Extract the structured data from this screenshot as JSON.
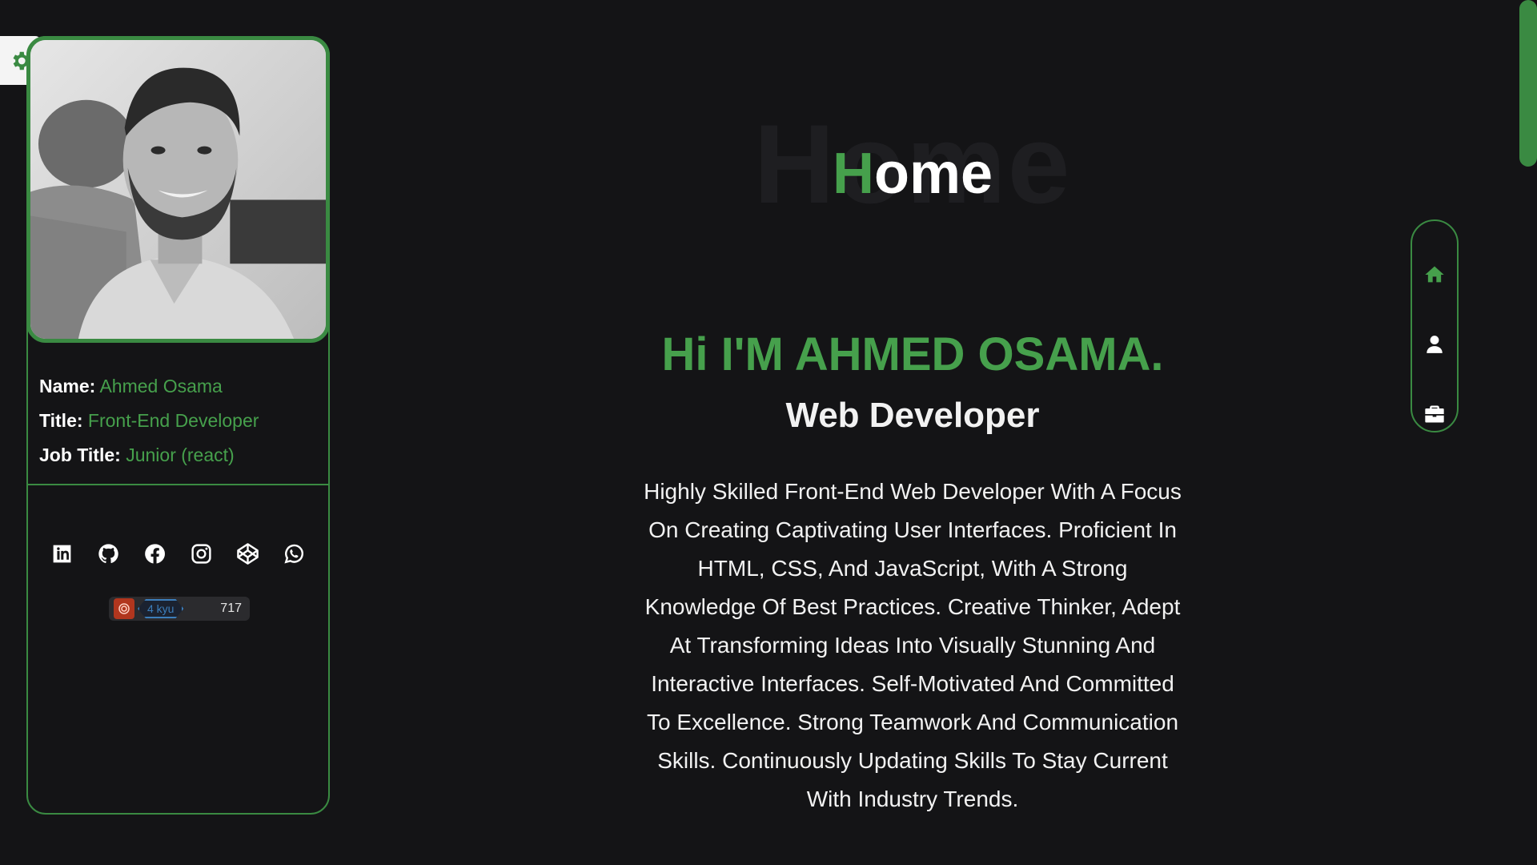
{
  "sidebar": {
    "photo_alt": "Ahmed Osama portrait",
    "info": [
      {
        "key": "Name:",
        "value": "Ahmed Osama"
      },
      {
        "key": "Title:",
        "value": "Front-End Developer"
      },
      {
        "key": "Job Title:",
        "value": "Junior (react)"
      }
    ],
    "socials": [
      "linkedin-icon",
      "github-icon",
      "facebook-icon",
      "instagram-icon",
      "codepen-icon",
      "whatsapp-icon"
    ],
    "codewars": {
      "rank": "4 kyu",
      "honor": "717"
    }
  },
  "main": {
    "title_bg": "Home",
    "title_accent": "H",
    "title_rest": "ome",
    "greeting": "Hi I'M AHMED OSAMA.",
    "role": "Web Developer",
    "bio": "Highly Skilled Front-End Web Developer With A Focus On Creating Captivating User Interfaces. Proficient In HTML, CSS, And JavaScript, With A Strong Knowledge Of Best Practices. Creative Thinker, Adept At Transforming Ideas Into Visually Stunning And Interactive Interfaces. Self-Motivated And Committed To Excellence. Strong Teamwork And Communication Skills. Continuously Updating Skills To Stay Current With Industry Trends."
  },
  "nav": {
    "items": [
      "home-icon",
      "user-icon",
      "briefcase-icon"
    ],
    "active": "home-icon"
  },
  "colors": {
    "accent": "#46a04c",
    "background": "#141416"
  }
}
